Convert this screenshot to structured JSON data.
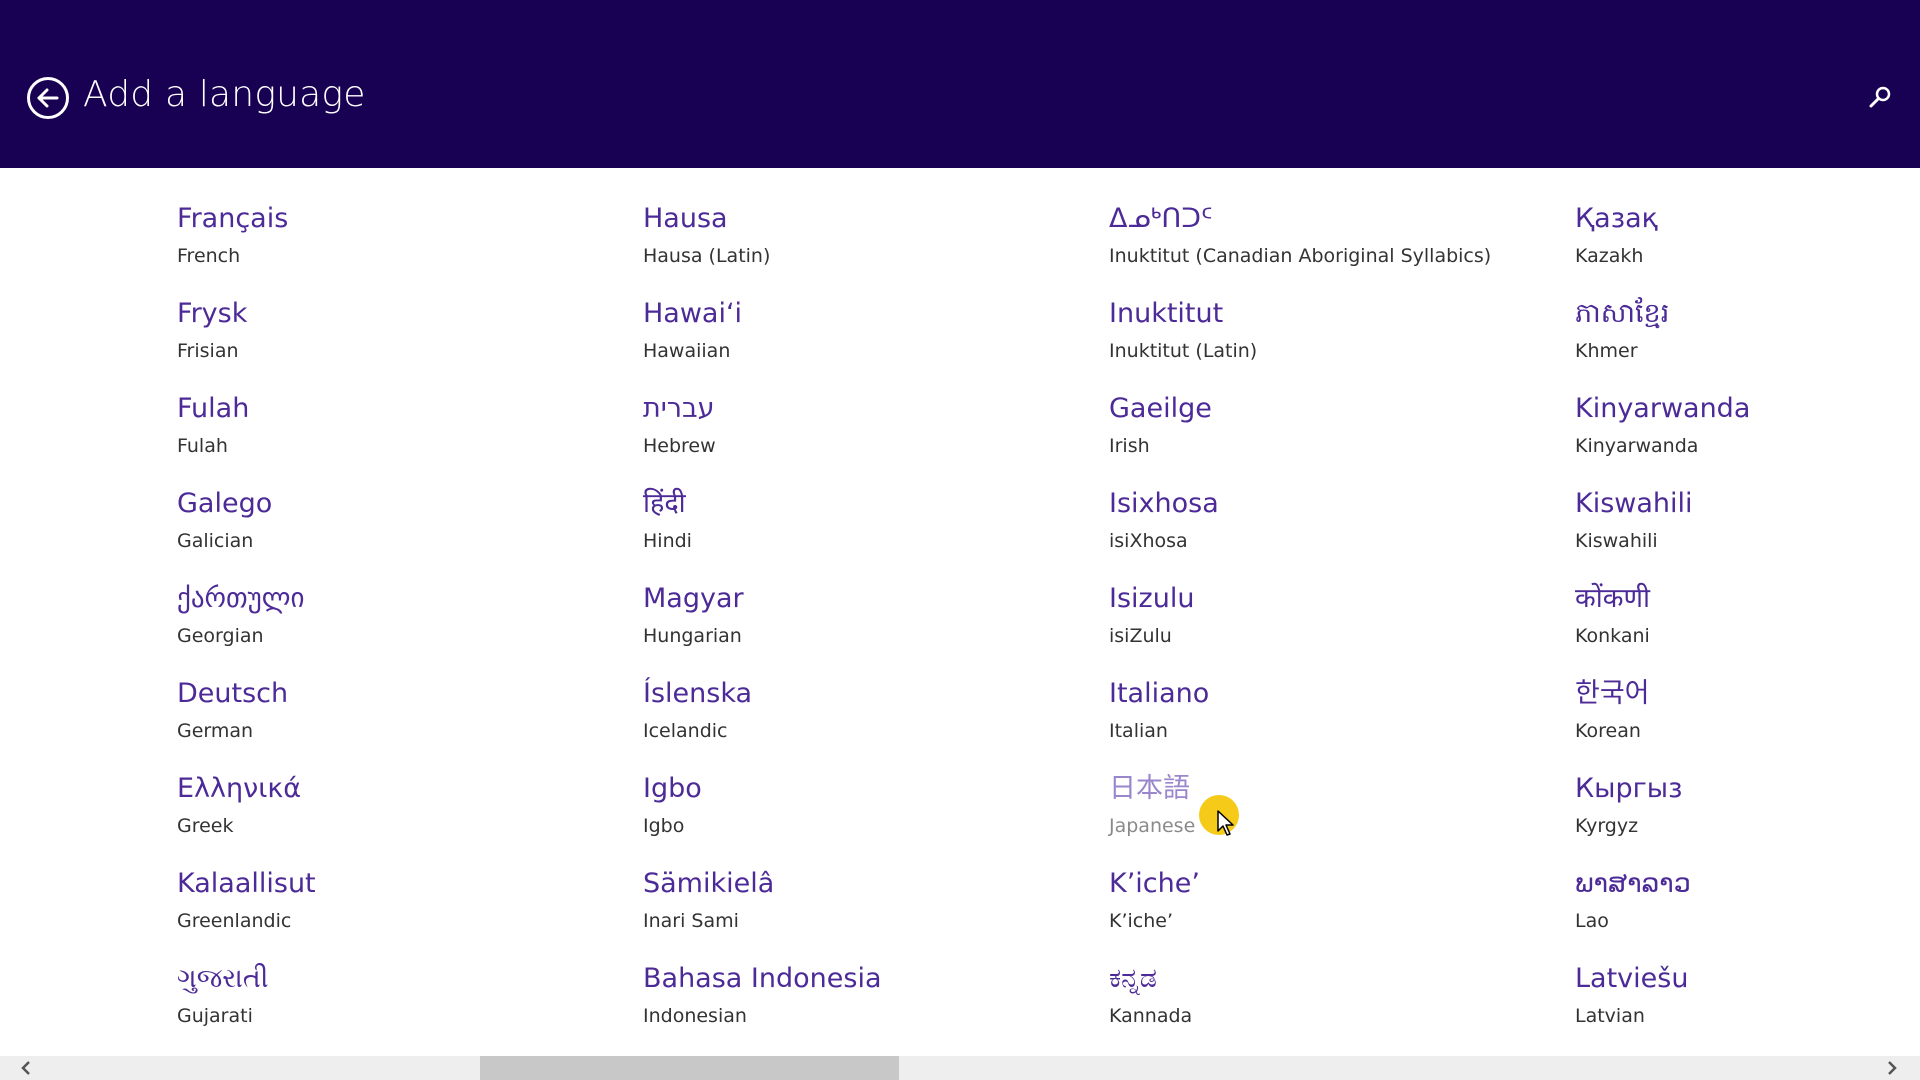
{
  "header": {
    "title": "Add a language",
    "back_icon": "back-arrow-circle-icon",
    "search_icon": "search-icon",
    "background_color": "#180052"
  },
  "languages": {
    "columns": [
      {
        "items": [
          {
            "native": "Français",
            "english": "French"
          },
          {
            "native": "Frysk",
            "english": "Frisian"
          },
          {
            "native": "Fulah",
            "english": "Fulah"
          },
          {
            "native": "Galego",
            "english": "Galician"
          },
          {
            "native": "ქართული",
            "english": "Georgian"
          },
          {
            "native": "Deutsch",
            "english": "German"
          },
          {
            "native": "Ελληνικά",
            "english": "Greek"
          },
          {
            "native": "Kalaallisut",
            "english": "Greenlandic"
          },
          {
            "native": "ગુજરાતી",
            "english": "Gujarati"
          }
        ]
      },
      {
        "items": [
          {
            "native": "Hausa",
            "english": "Hausa (Latin)"
          },
          {
            "native": "Hawaiʻi",
            "english": "Hawaiian"
          },
          {
            "native": "עברית",
            "english": "Hebrew"
          },
          {
            "native": "हिंदी",
            "english": "Hindi"
          },
          {
            "native": "Magyar",
            "english": "Hungarian"
          },
          {
            "native": "Íslenska",
            "english": "Icelandic"
          },
          {
            "native": "Igbo",
            "english": "Igbo"
          },
          {
            "native": "Sämikielâ",
            "english": "Inari Sami"
          },
          {
            "native": "Bahasa Indonesia",
            "english": "Indonesian"
          }
        ]
      },
      {
        "items": [
          {
            "native": "ᐃᓄᒃᑎᑐᑦ",
            "english": "Inuktitut (Canadian Aboriginal Syllabics)"
          },
          {
            "native": "Inuktitut",
            "english": "Inuktitut (Latin)"
          },
          {
            "native": "Gaeilge",
            "english": "Irish"
          },
          {
            "native": "Isixhosa",
            "english": "isiXhosa"
          },
          {
            "native": "Isizulu",
            "english": "isiZulu"
          },
          {
            "native": "Italiano",
            "english": "Italian"
          },
          {
            "native": "日本語",
            "english": "Japanese",
            "hover": true
          },
          {
            "native": "K’iche’",
            "english": "K’iche’"
          },
          {
            "native": "ಕನ್ನಡ",
            "english": "Kannada"
          }
        ]
      },
      {
        "items": [
          {
            "native": "Қазақ",
            "english": "Kazakh"
          },
          {
            "native": "ភាសាខ្មែរ",
            "english": "Khmer"
          },
          {
            "native": "Kinyarwanda",
            "english": "Kinyarwanda"
          },
          {
            "native": "Kiswahili",
            "english": "Kiswahili"
          },
          {
            "native": "कोंकणी",
            "english": "Konkani"
          },
          {
            "native": "한국어",
            "english": "Korean"
          },
          {
            "native": "Кыргыз",
            "english": "Kyrgyz"
          },
          {
            "native": "ພາສາລາວ",
            "english": "Lao"
          },
          {
            "native": "Latviešu",
            "english": "Latvian"
          }
        ]
      }
    ]
  },
  "scrollbar": {
    "left_icon": "chevron-left-icon",
    "right_icon": "chevron-right-icon",
    "position_fraction": 0.32
  },
  "colors": {
    "accent": "#4c2a97",
    "hover_native": "#9a86cc",
    "secondary_text": "#333333",
    "cursor_highlight": "#f4c400"
  }
}
